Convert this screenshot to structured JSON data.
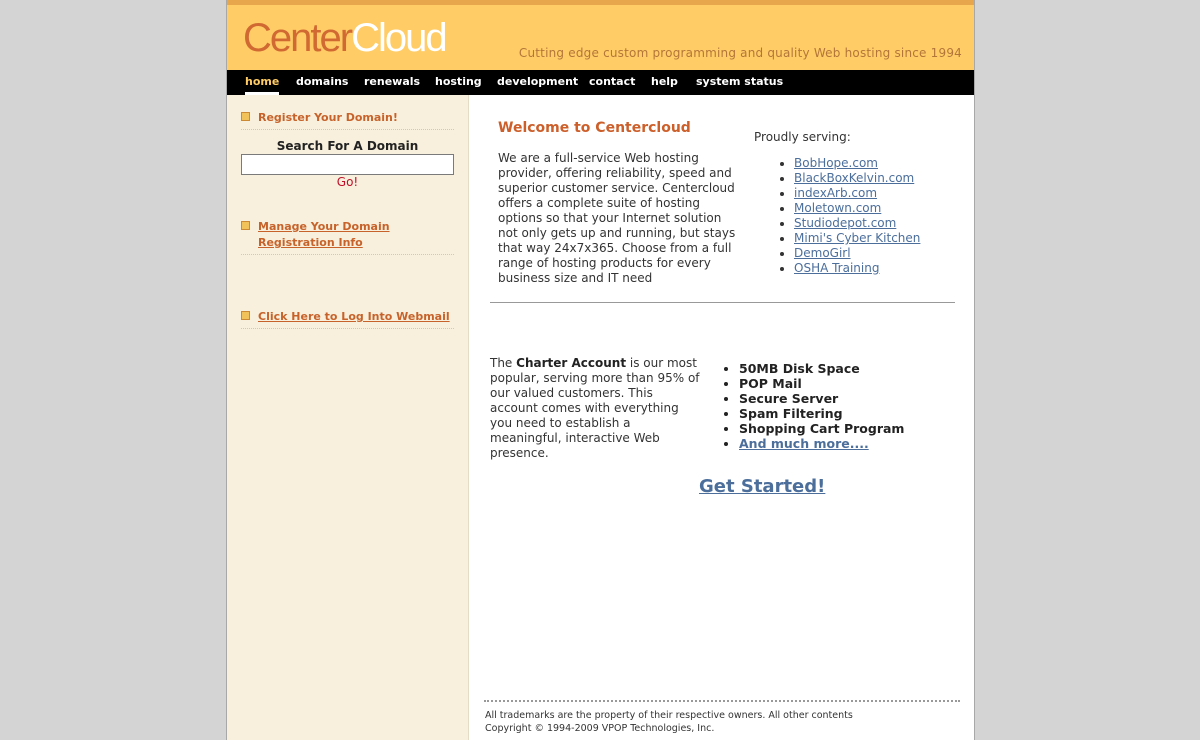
{
  "header": {
    "logo_part1": "Center",
    "logo_part2": "Cloud",
    "tagline": "Cutting edge custom programming and quality Web hosting since 1994"
  },
  "nav": {
    "items": [
      {
        "label": "home",
        "active": true
      },
      {
        "label": "domains"
      },
      {
        "label": "renewals"
      },
      {
        "label": "hosting"
      },
      {
        "label": "development"
      },
      {
        "label": "contact"
      },
      {
        "label": "help"
      },
      {
        "label": "system status"
      }
    ]
  },
  "sidebar": {
    "register_link": "Register Your Domain!",
    "search_title": "Search For A Domain",
    "search_value": "",
    "go_label": "Go!",
    "manage_link_line1": "Manage Your Domain",
    "manage_link_line2": "Registration Info",
    "webmail_link": "Click Here to Log Into Webmail"
  },
  "main": {
    "welcome_title": "Welcome to Centercloud",
    "welcome_text": "We are a full-service Web hosting provider, offering reliability, speed and superior customer service. Centercloud offers a complete suite of hosting options so that your Internet solution not only gets up and running, but stays that way 24x7x365. Choose from a full range of hosting products for every business size and IT need",
    "serving_title": "Proudly serving:",
    "clients": [
      "BobHope.com",
      "BlackBoxKelvin.com",
      "indexArb.com",
      "Moletown.com",
      "Studiodepot.com",
      "Mimi's Cyber Kitchen",
      "DemoGirl",
      "OSHA Training"
    ],
    "charter_intro": "The ",
    "charter_bold": "Charter Account",
    "charter_rest": " is our most popular, serving more than 95% of our valued customers. This account comes with everything you need to establish a meaningful, interactive Web presence.",
    "features": [
      "50MB Disk Space",
      "POP Mail",
      "Secure Server",
      "Spam Filtering",
      "Shopping Cart Program"
    ],
    "more_link": "And much more....",
    "cta": "Get Started!"
  },
  "footer": {
    "line1": "All trademarks are the property of their respective owners. All other contents",
    "line2": "Copyright © 1994-2009 VPOP Technologies, Inc."
  },
  "colors": {
    "header_bg": "#ffcc66",
    "accent_orange": "#cc5f2a",
    "link_blue": "#4b6e9b",
    "sidebar_bg": "#f8f0dc",
    "nav_bg": "#000000"
  }
}
